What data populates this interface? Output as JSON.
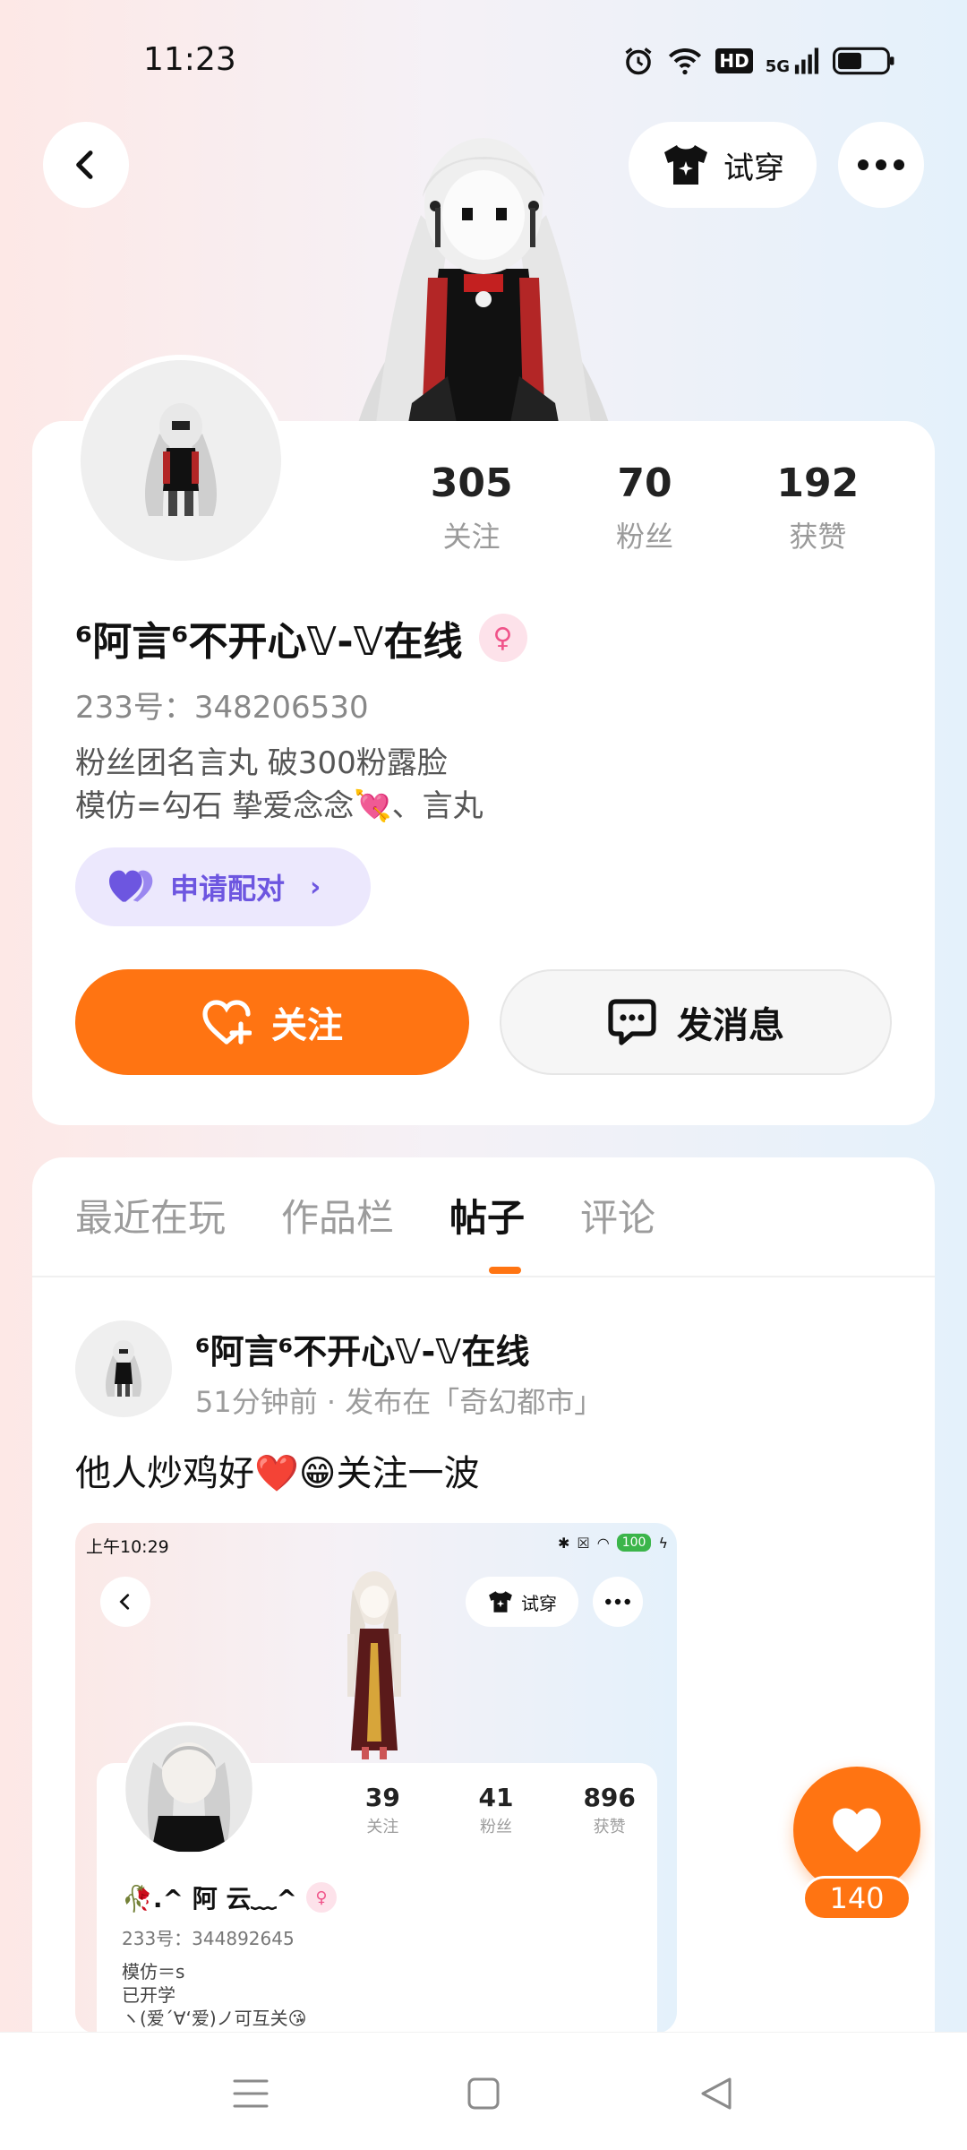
{
  "status_bar": {
    "time": "11:23",
    "hd": "HD",
    "network": "5G"
  },
  "header": {
    "tryon_label": "试穿"
  },
  "profile": {
    "stats": [
      {
        "value": "305",
        "label": "关注"
      },
      {
        "value": "70",
        "label": "粉丝"
      },
      {
        "value": "192",
        "label": "获赞"
      }
    ],
    "nickname": "⁶阿言⁶不开心𝕍-𝕍在线",
    "gender_symbol": "♀",
    "id_line": "233号：348206530",
    "bio_lines": [
      "粉丝团名言丸 破300粉露脸",
      "模仿=勾石 挚爱念念💘、言丸"
    ],
    "pair_label": "申请配对",
    "follow_label": "关注",
    "message_label": "发消息"
  },
  "tabs": [
    {
      "label": "最近在玩",
      "active": false
    },
    {
      "label": "作品栏",
      "active": false
    },
    {
      "label": "帖子",
      "active": true
    },
    {
      "label": "评论",
      "active": false
    }
  ],
  "post": {
    "author": "⁶阿言⁶不开心𝕍-𝕍在线",
    "meta": "51分钟前 · 发布在「奇幻都市」",
    "text": "他人炒鸡好❤️😁关注一波",
    "image": {
      "time": "上午10:29",
      "battery": "100",
      "tryon_label": "试穿",
      "stats": [
        {
          "value": "39",
          "label": "关注"
        },
        {
          "value": "41",
          "label": "粉丝"
        },
        {
          "value": "896",
          "label": "获赞"
        }
      ],
      "name": "🥀.^ 阿 云﹏^",
      "gender_symbol": "♀",
      "id_line": "233号：344892645",
      "bio_lines": [
        "模仿＝s",
        "已开学",
        "ヽ(爱´∀‘爱)ノ可互关😘"
      ]
    }
  },
  "like": {
    "count": "140"
  },
  "colors": {
    "accent": "#ff7412",
    "pair": "#6d56e0"
  }
}
